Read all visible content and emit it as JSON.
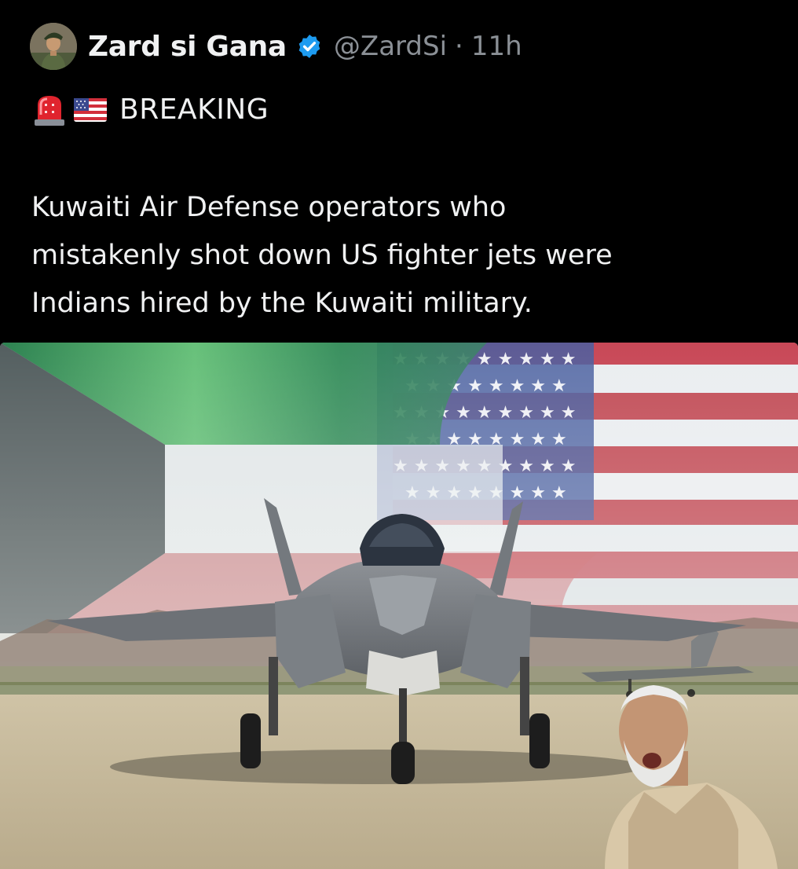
{
  "author": {
    "display_name": "Zard si Gana",
    "handle": "@ZardSi",
    "separator": "·",
    "timestamp": "11h",
    "verified": true,
    "avatar_icon": "soldier-avatar"
  },
  "post": {
    "emoji_1": "police-car-light-icon",
    "emoji_2": "us-flag-icon",
    "breaking_label": "BREAKING",
    "text_lines": [
      "Kuwaiti Air Defense operators who",
      "mistakenly shot down US fighter jets were",
      "Indians hired by the Kuwaiti military."
    ]
  },
  "media": {
    "description_icon": "fighter-jet-flags-image"
  },
  "colors": {
    "background": "#000000",
    "text": "#f0f1f2",
    "secondary_text": "#8b9096",
    "verified_blue": "#1d9bf0"
  }
}
